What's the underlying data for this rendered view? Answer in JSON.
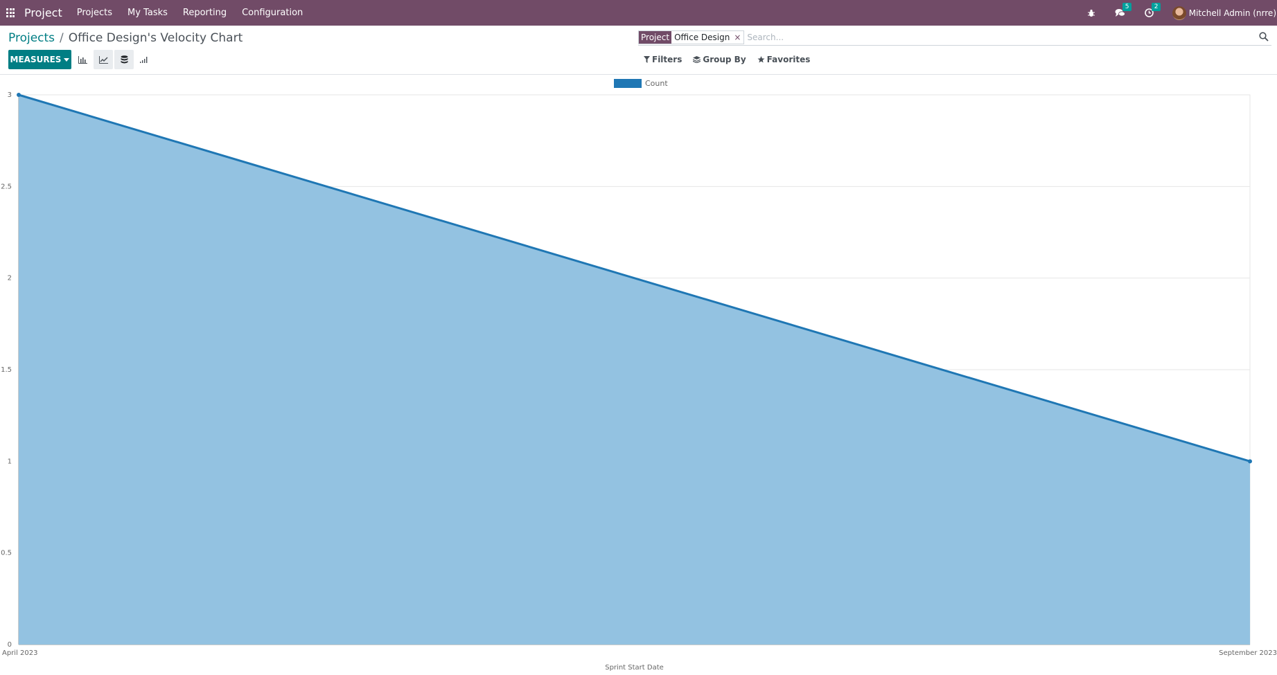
{
  "navbar": {
    "app_name": "Project",
    "menu": [
      "Projects",
      "My Tasks",
      "Reporting",
      "Configuration"
    ],
    "messages_count": "5",
    "activities_count": "2",
    "user": "Mitchell Admin (nrre)",
    "color": "#714b67"
  },
  "breadcrumb": {
    "parent": "Projects",
    "separator": "/",
    "current": "Office Design's Velocity Chart"
  },
  "toolbar": {
    "measures_label": "MEASURES",
    "views": [
      "bar-chart-icon",
      "line-chart-icon",
      "stacked-icon",
      "descending-icon"
    ],
    "accent_color": "#017e84"
  },
  "search": {
    "facet_category": "Project",
    "facet_value": "Office Design",
    "facet_remove": "×",
    "placeholder": "Search..."
  },
  "filters": {
    "filters_label": "Filters",
    "groupby_label": "Group By",
    "favorites_label": "Favorites"
  },
  "chart_data": {
    "type": "area",
    "categories": [
      "April 2023",
      "September 2023"
    ],
    "series": [
      {
        "name": "Count",
        "values": [
          3,
          1
        ],
        "color": "#1f77b4",
        "fill": "#93c2e1"
      }
    ],
    "xlabel": "Sprint Start Date",
    "ylabel": "",
    "ylim": [
      0,
      3
    ],
    "yticks": [
      "0",
      "0.5",
      "1",
      "1.5",
      "2",
      "2.5",
      "3"
    ],
    "grid": true,
    "legend": "top-center"
  }
}
